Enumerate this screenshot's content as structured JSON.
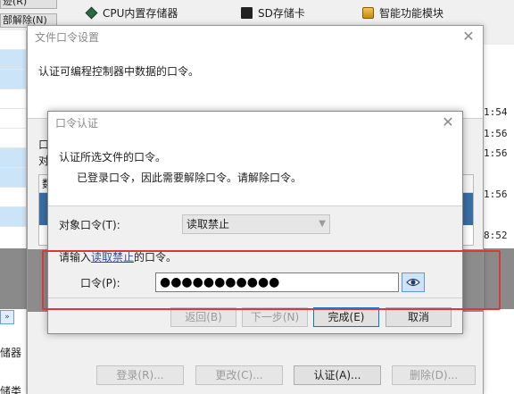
{
  "background": {
    "toolbar_btn_1": "迹(R)",
    "toolbar_btn_2": "部解除(N)",
    "storage_tabs": [
      "CPU内置存储器",
      "SD存储卡",
      "智能功能模块"
    ],
    "left_labels": [
      "储器",
      "储类"
    ],
    "times": [
      "1:54",
      "1:56",
      "1:56",
      "1:56",
      "8:52"
    ]
  },
  "outer_dialog": {
    "title": "文件口令设置",
    "description": "认证可编程控制器中数据的口令。",
    "body_labels": [
      "口",
      "对"
    ],
    "list_header": "数",
    "buttons": {
      "login": "登录(R)...",
      "change": "更改(C)...",
      "authenticate": "认证(A)...",
      "delete": "删除(D)..."
    }
  },
  "inner_dialog": {
    "title": "口令认证",
    "message_1": "认证所选文件的口令。",
    "message_2": "已登录口令，因此需要解除口令。请解除口令。",
    "target_label": "对象口令(T):",
    "target_value": "读取禁止",
    "prompt_prefix": "请输入",
    "prompt_highlight": "读取禁止",
    "prompt_suffix": "的口令。",
    "password_label": "口令(P):",
    "password_value": "●●●●●●●●●●●",
    "buttons": {
      "back": "返回(B)",
      "next": "下一步(N)",
      "finish": "完成(E)",
      "cancel": "取消"
    }
  },
  "colors": {
    "highlight_box": "#d83a3a",
    "accent": "#0078d7",
    "link_text": "#2a4fb5"
  }
}
